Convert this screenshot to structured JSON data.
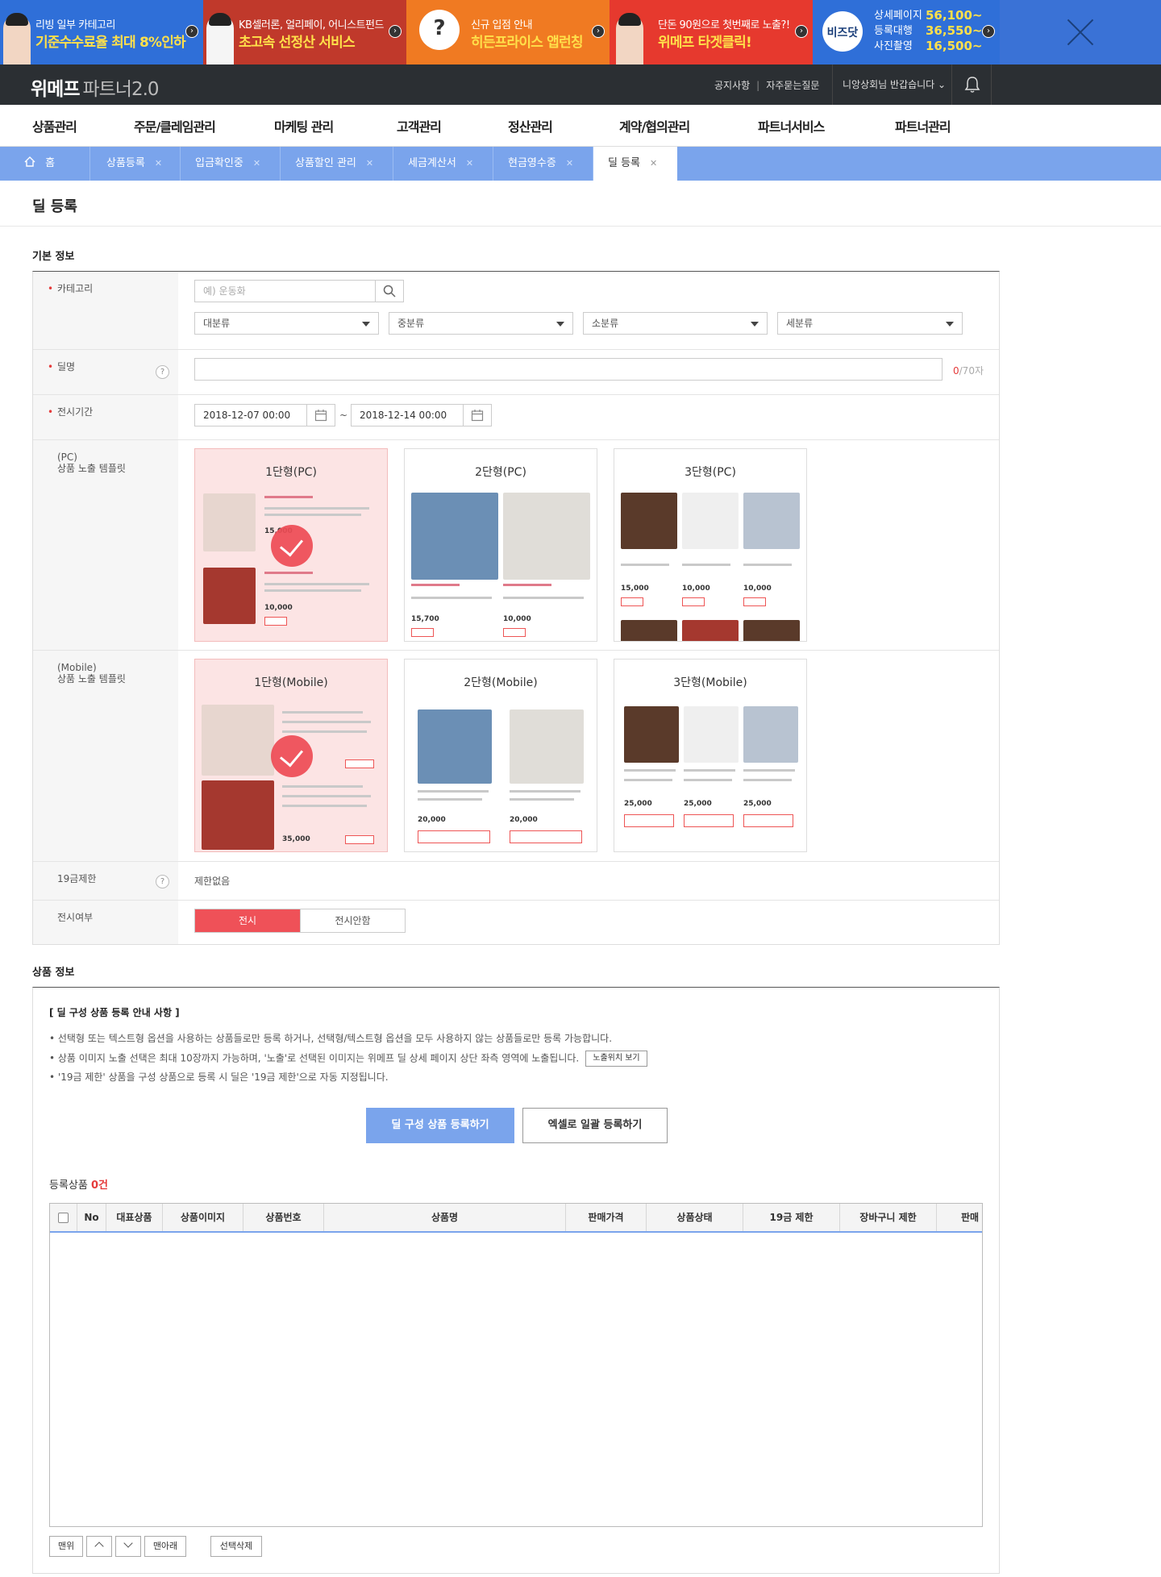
{
  "banners": [
    {
      "line1": "리빙 일부 카테고리",
      "line2": "기준수수료율 최대 8%인하"
    },
    {
      "line1": "KB셀러론, 얼리페이, 어니스트펀드",
      "line2": "초고속 선정산 서비스"
    },
    {
      "line1": "신규 입점 안내",
      "line2": "히든프라이스 앱런칭"
    },
    {
      "line1": "단돈 90원으로 첫번째로 노출?!",
      "line2": "위메프 타겟클릭!"
    }
  ],
  "bizbanner": {
    "logo": "비즈닷",
    "rows": [
      {
        "label": "상세페이지",
        "price": "56,100~"
      },
      {
        "label": "등록대행",
        "price": "36,550~"
      },
      {
        "label": "사진촬영",
        "price": "16,500~"
      }
    ]
  },
  "header": {
    "logo": "위메프",
    "logo_sub": "파트너2.0",
    "notice": "공지사항",
    "faq": "자주묻는질문",
    "user": "니앙상회님 반갑습니다 ⌄"
  },
  "gnb": [
    "상품관리",
    "주문/클레임관리",
    "마케팅 관리",
    "고객관리",
    "정산관리",
    "계약/협의관리",
    "파트너서비스",
    "파트너관리"
  ],
  "tabs": {
    "home": "홈",
    "items": [
      "상품등록",
      "입금확인중",
      "상품할인 관리",
      "세금계산서",
      "현금영수증"
    ],
    "active": "딜 등록"
  },
  "page": {
    "title": "딜 등록"
  },
  "basic": {
    "section_title": "기본 정보",
    "category_label": "카테고리",
    "category_placeholder": "예) 운동화",
    "selects": [
      "대분류",
      "중분류",
      "소분류",
      "세분류"
    ],
    "deal_label": "딜명",
    "deal_count": "0",
    "deal_count_max": "/70자",
    "period_label": "전시기간",
    "start": "2018-12-07 00:00",
    "tilde": "~",
    "end": "2018-12-14 00:00",
    "pc_label_1": "(PC)",
    "pc_label_2": "상품 노출 템플릿",
    "pc_templates": [
      "1단형(PC)",
      "2단형(PC)",
      "3단형(PC)"
    ],
    "mobile_label_1": "(Mobile)",
    "mobile_label_2": "상품 노출 템플릿",
    "mobile_templates": [
      "1단형(Mobile)",
      "2단형(Mobile)",
      "3단형(Mobile)"
    ],
    "adult_label": "19금제한",
    "adult_value": "제한없음",
    "display_label": "전시여부",
    "display_on": "전시",
    "display_off": "전시안함"
  },
  "product": {
    "section_title": "상품 정보",
    "notice_title": "[ 딜 구성 상품 등록 안내 사항 ]",
    "notice_lines": [
      "• 선택형 또는 텍스트형 옵션을 사용하는 상품들로만 등록 하거나, 선택형/텍스트형 옵션을 모두 사용하지 않는 상품들로만 등록 가능합니다.",
      "• 상품 이미지 노출 선택은 최대 10장까지 가능하며, '노출'로 선택된 이미지는 위메프 딜 상세 페이지 상단 좌측 영역에 노출됩니다.",
      "• '19금 제한' 상품을 구성 상품으로 등록 시 딜은 '19금 제한'으로 자동 지정됩니다."
    ],
    "position_btn": "노출위치 보기",
    "register_btn": "딜 구성 상품 등록하기",
    "excel_btn": "엑셀로 일괄 등록하기",
    "registered_label": "등록상품",
    "registered_count": "0건",
    "columns": [
      "No",
      "대표상품",
      "상품이미지",
      "상품번호",
      "상품명",
      "판매가격",
      "상품상태",
      "19금 제한",
      "장바구니 제한",
      "판매"
    ],
    "controls": {
      "top": "맨위",
      "bottom": "맨아래",
      "delete": "선택삭제"
    }
  }
}
